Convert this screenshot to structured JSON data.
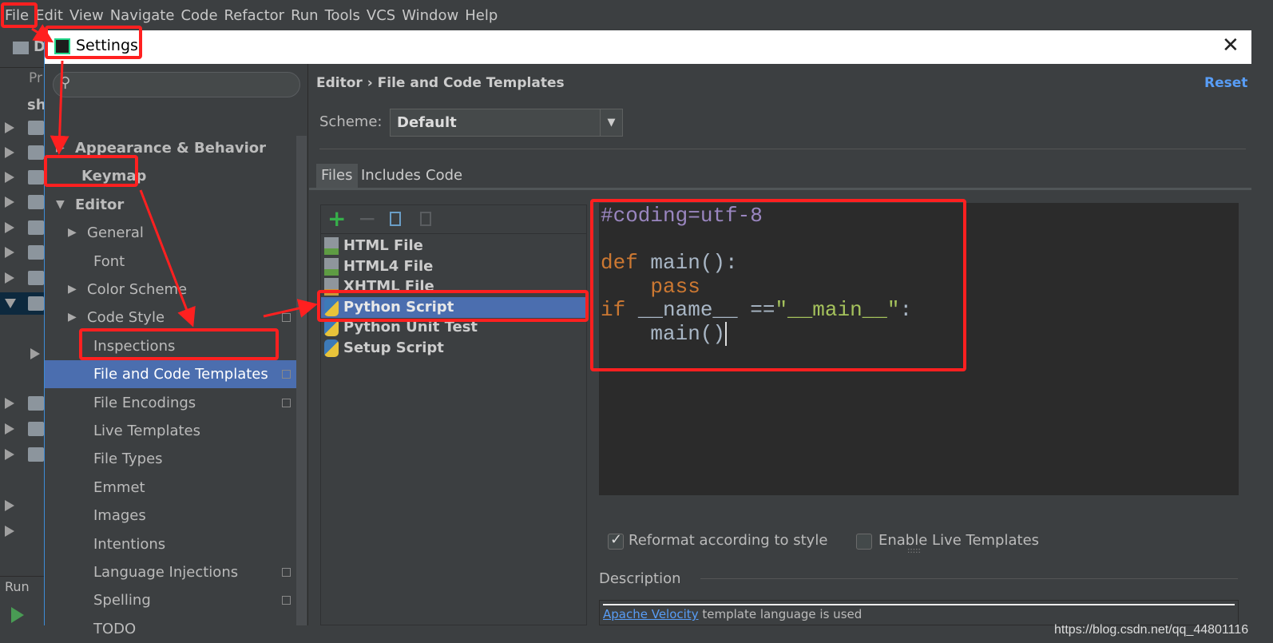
{
  "menu": [
    "File",
    "Edit",
    "View",
    "Navigate",
    "Code",
    "Refactor",
    "Run",
    "Tools",
    "VCS",
    "Window",
    "Help"
  ],
  "ide": {
    "project_label": "D",
    "project_tab": "Pr",
    "root": "sh",
    "run_label": "Run"
  },
  "dialog": {
    "title": "Settings",
    "close_icon": "close-icon"
  },
  "tree": [
    {
      "label": "Appearance & Behavior",
      "bold": true
    },
    {
      "label": "Keymap",
      "bold": true
    },
    {
      "label": "Editor",
      "bold": true,
      "expanded": true
    },
    {
      "label": "General"
    },
    {
      "label": "Font"
    },
    {
      "label": "Color Scheme"
    },
    {
      "label": "Code Style"
    },
    {
      "label": "Inspections"
    },
    {
      "label": "File and Code Templates",
      "selected": true
    },
    {
      "label": "File Encodings"
    },
    {
      "label": "Live Templates"
    },
    {
      "label": "File Types"
    },
    {
      "label": "Emmet"
    },
    {
      "label": "Images"
    },
    {
      "label": "Intentions"
    },
    {
      "label": "Language Injections"
    },
    {
      "label": "Spelling"
    },
    {
      "label": "TODO"
    }
  ],
  "breadcrumb": "Editor › File and Code Templates",
  "reset": "Reset",
  "scheme": {
    "label": "Scheme:",
    "value": "Default"
  },
  "tabs": [
    "Files",
    "Includes",
    "Code"
  ],
  "templates": [
    "HTML File",
    "HTML4 File",
    "XHTML File",
    "Python Script",
    "Python Unit Test",
    "Setup Script"
  ],
  "selected_template": "Python Script",
  "code": {
    "l1": "#coding=utf-8",
    "def": "def",
    "main_sig": " main():",
    "pass": "pass",
    "if": "if",
    "name": " __name__ ==",
    "str": "\"__main__\"",
    "colon": ":",
    "call": "main()"
  },
  "options": {
    "reformat": "Reformat according to style",
    "reformat_checked": true,
    "live": "Enable Live Templates",
    "live_checked": false
  },
  "description": {
    "heading": "Description",
    "link": "Apache Velocity",
    "text": " template language is used"
  },
  "watermark": "https://blog.csdn.net/qq_44801116",
  "colors": {
    "accent": "#4b6eaf",
    "annotation": "#ff2020",
    "link": "#589df6"
  }
}
